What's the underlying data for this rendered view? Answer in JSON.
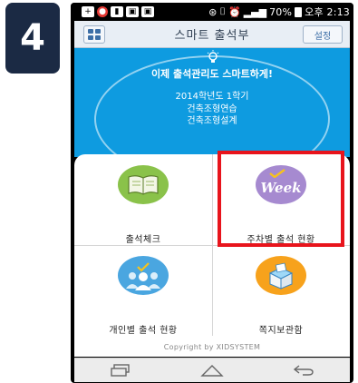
{
  "step_badge": "4",
  "status_bar": {
    "battery": "70%",
    "clock": "오후 2:13"
  },
  "header": {
    "title": "스마트 출석부",
    "settings_label": "설정"
  },
  "banner": {
    "headline": "이제 출석관리도 스마트하게!",
    "semester": "2014학년도 1학기",
    "courses": [
      "건축조형연습",
      "건축조형설계"
    ]
  },
  "menu": {
    "items": [
      {
        "label": "출석체크",
        "icon": "book-icon",
        "color": "#8ac24a"
      },
      {
        "label": "주차별 출석 현황",
        "icon": "week-icon",
        "icon_text": "Week",
        "color": "#a68ad0"
      },
      {
        "label": "개인별 출석 현황",
        "icon": "people-icon",
        "color": "#4aa6e0"
      },
      {
        "label": "쪽지보관함",
        "icon": "box-icon",
        "color": "#f7a21c"
      }
    ]
  },
  "copyright": "Copyright by XIDSYSTEM",
  "colors": {
    "banner": "#0e9be0",
    "highlight": "#e8141c",
    "badge": "#1b2a44"
  }
}
